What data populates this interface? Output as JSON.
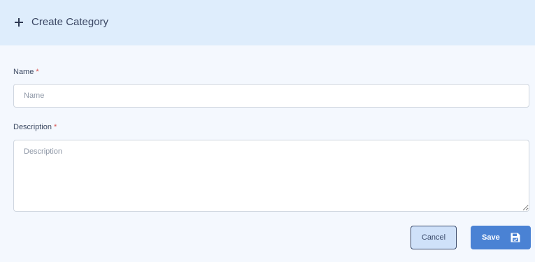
{
  "header": {
    "icon": "plus-icon",
    "title": "Create Category"
  },
  "form": {
    "name": {
      "label": "Name",
      "required_mark": "*",
      "placeholder": "Name",
      "value": ""
    },
    "description": {
      "label": "Description",
      "required_mark": "*",
      "placeholder": "Description",
      "value": ""
    }
  },
  "actions": {
    "cancel_label": "Cancel",
    "save_label": "Save",
    "save_icon": "floppy-disk-icon"
  },
  "colors": {
    "header_bg": "#deedfc",
    "page_bg": "#f4f8fe",
    "primary": "#4a82d4",
    "cancel_bg": "#cfe1f9",
    "required": "#d9534f"
  }
}
